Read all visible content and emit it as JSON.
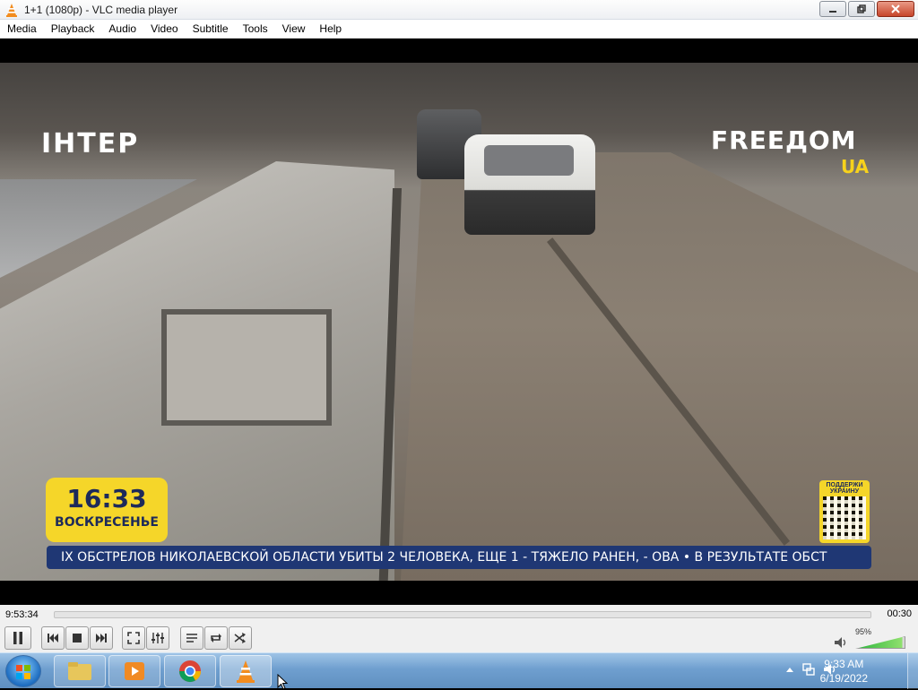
{
  "window": {
    "title": "1+1 (1080p) - VLC media player"
  },
  "menu": [
    "Media",
    "Playback",
    "Audio",
    "Video",
    "Subtitle",
    "Tools",
    "View",
    "Help"
  ],
  "video": {
    "channel_logo": "ІНТЕР",
    "freedom_logo": "FREEДOM",
    "freedom_ua": "UA",
    "clock_time": "16:33",
    "clock_day": "ВОСКРЕСЕНЬЕ",
    "qr_label": "ПОДДЕРЖИ УКРАИНУ",
    "ticker": "IX ОБСТРЕЛОВ НИКОЛАЕВСКОЙ ОБЛАСТИ УБИТЫ 2 ЧЕЛОВЕКА, ЕЩЕ 1 - ТЯЖЕЛО РАНЕН, - ОВА   •   В РЕЗУЛЬТАТЕ ОБСТ"
  },
  "playback": {
    "elapsed": "9:53:34",
    "remaining": "00:30",
    "progress": 0.0
  },
  "volume": {
    "percent_label": "95%",
    "level": 0.95
  },
  "taskbar": {
    "clock_time": "9:33 AM",
    "clock_date": "6/19/2022"
  },
  "colors": {
    "ticker_bg": "#1f3774",
    "clock_bg": "#f5d629",
    "vlc_orange": "#f28c1f"
  }
}
